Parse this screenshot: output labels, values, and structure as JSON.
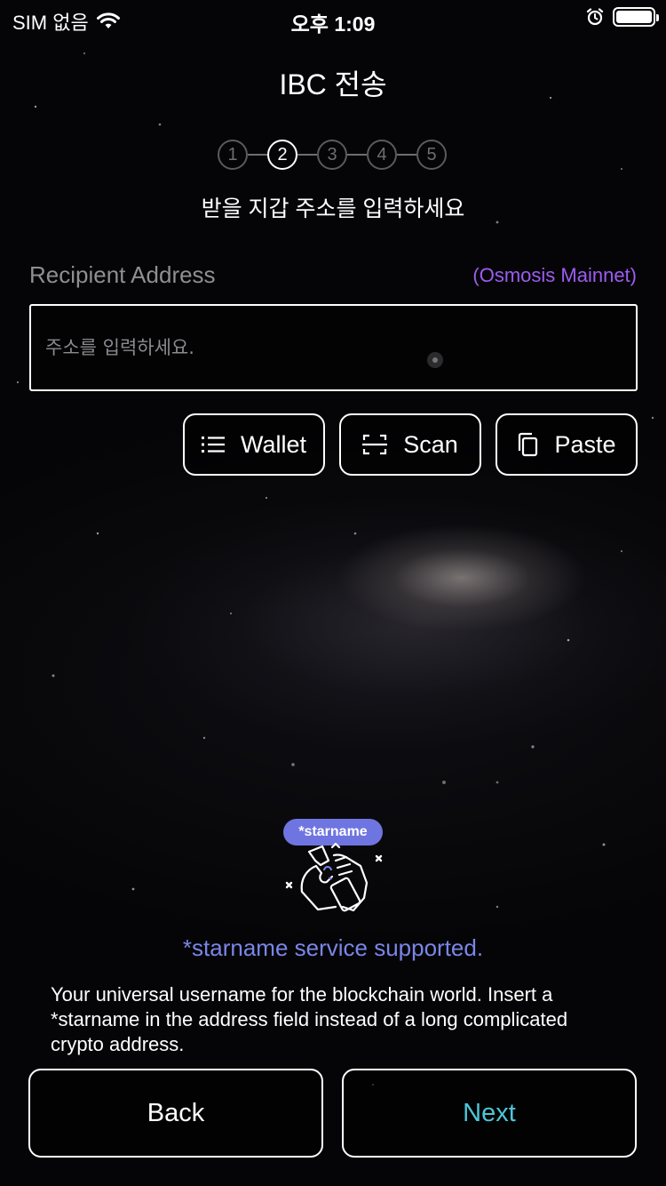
{
  "status_bar": {
    "carrier": "SIM 없음",
    "time": "오후 1:09",
    "wifi_icon": "wifi-icon",
    "alarm_icon": "alarm-icon",
    "battery_icon": "battery-icon"
  },
  "header": {
    "title": "IBC 전송"
  },
  "steps": {
    "items": [
      "1",
      "2",
      "3",
      "4",
      "5"
    ],
    "current": 2
  },
  "subtitle": "받을 지갑 주소를 입력하세요",
  "recipient": {
    "label": "Recipient Address",
    "chain": "(Osmosis Mainnet)",
    "value": "",
    "placeholder": "주소를 입력하세요."
  },
  "tools": {
    "wallet": {
      "label": "Wallet",
      "icon": "list-icon"
    },
    "scan": {
      "label": "Scan",
      "icon": "scan-icon"
    },
    "paste": {
      "label": "Paste",
      "icon": "copy-icon"
    }
  },
  "starname": {
    "badge": "*starname",
    "supported": "*starname service supported.",
    "description": "Your universal username for the blockchain world. Insert a *starname in the address field instead of a long complicated crypto address."
  },
  "footer": {
    "back_label": "Back",
    "next_label": "Next"
  },
  "colors": {
    "background": "#050507",
    "accent_purple": "#9d5cf0",
    "starname_blue": "#7a86e8",
    "badge_blue": "#6f75e0",
    "next_cyan": "#4ec6d8"
  }
}
